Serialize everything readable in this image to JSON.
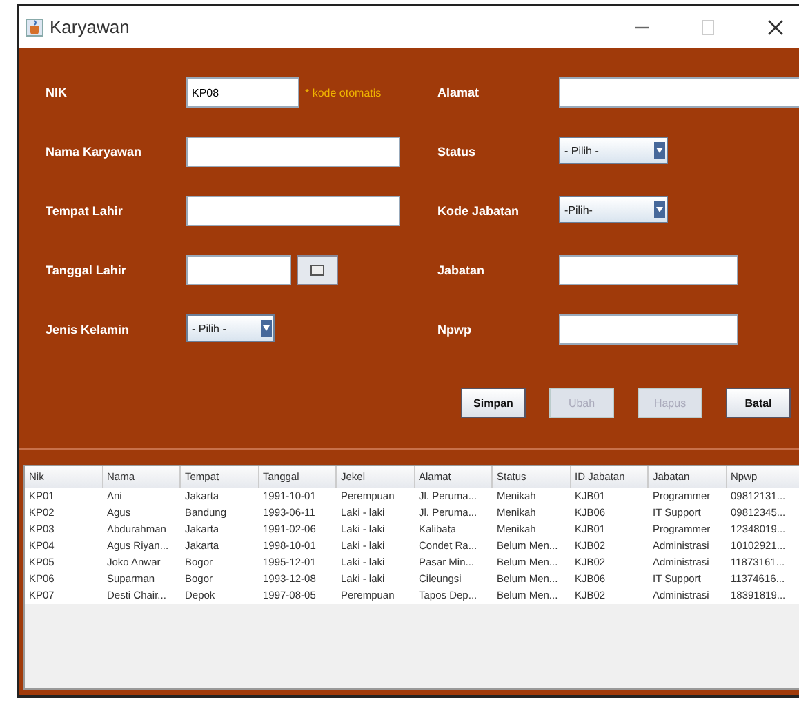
{
  "window": {
    "title": "Karyawan"
  },
  "form": {
    "left": [
      {
        "kind": "short_text",
        "label": "NIK",
        "value": "KP08",
        "note": "* kode otomatis"
      },
      {
        "kind": "text",
        "label": "Nama Karyawan"
      },
      {
        "kind": "text",
        "label": "Tempat Lahir"
      },
      {
        "kind": "date",
        "label": "Tanggal Lahir"
      },
      {
        "kind": "combo",
        "label": "Jenis Kelamin",
        "value": "- Pilih -"
      }
    ],
    "right": [
      {
        "kind": "wide_text",
        "label": "Alamat"
      },
      {
        "kind": "combo",
        "label": "Status",
        "value": "- Pilih -"
      },
      {
        "kind": "combo",
        "label": "Kode Jabatan",
        "value": "-Pilih-"
      },
      {
        "kind": "text",
        "label": "Jabatan"
      },
      {
        "kind": "text",
        "label": "Npwp"
      }
    ]
  },
  "buttons": [
    {
      "label": "Simpan",
      "disabled": false
    },
    {
      "label": "Ubah",
      "disabled": true
    },
    {
      "label": "Hapus",
      "disabled": true
    },
    {
      "label": "Batal",
      "disabled": false
    }
  ],
  "table": {
    "columns": [
      "Nik",
      "Nama",
      "Tempat",
      "Tanggal",
      "Jekel",
      "Alamat",
      "Status",
      "ID Jabatan",
      "Jabatan",
      "Npwp"
    ],
    "rows": [
      [
        "KP01",
        "Ani",
        "Jakarta",
        "1991-10-01",
        "Perempuan",
        "Jl. Peruma...",
        "Menikah",
        "KJB01",
        "Programmer",
        "09812131..."
      ],
      [
        "KP02",
        "Agus",
        "Bandung",
        "1993-06-11",
        "Laki - laki",
        "Jl. Peruma...",
        "Menikah",
        "KJB06",
        "IT Support",
        "09812345..."
      ],
      [
        "KP03",
        "Abdurahman",
        "Jakarta",
        "1991-02-06",
        "Laki - laki",
        "Kalibata",
        "Menikah",
        "KJB01",
        "Programmer",
        "12348019..."
      ],
      [
        "KP04",
        "Agus Riyan...",
        "Jakarta",
        "1998-10-01",
        "Laki - laki",
        "Condet Ra...",
        "Belum Men...",
        "KJB02",
        "Administrasi",
        "10102921..."
      ],
      [
        "KP05",
        "Joko Anwar",
        "Bogor",
        "1995-12-01",
        "Laki - laki",
        "Pasar Min...",
        "Belum Men...",
        "KJB02",
        "Administrasi",
        "11873161..."
      ],
      [
        "KP06",
        "Suparman",
        "Bogor",
        "1993-12-08",
        "Laki - laki",
        "Cileungsi",
        "Belum Men...",
        "KJB06",
        "IT Support",
        "11374616..."
      ],
      [
        "KP07",
        "Desti Chair...",
        "Depok",
        "1997-08-05",
        "Perempuan",
        "Tapos Dep...",
        "Belum Men...",
        "KJB02",
        "Administrasi",
        "18391819..."
      ]
    ]
  }
}
